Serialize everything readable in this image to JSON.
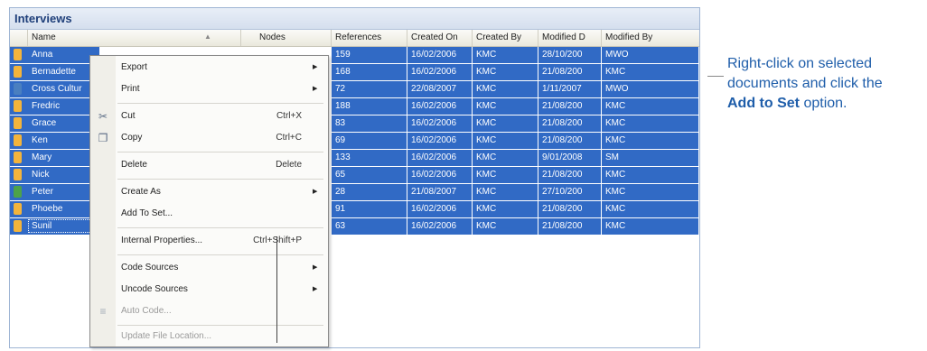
{
  "panel": {
    "title": "Interviews"
  },
  "columns": [
    "Name",
    "Nodes",
    "References",
    "Created On",
    "Created By",
    "Modified D",
    "Modified By"
  ],
  "rows": [
    {
      "name": "Anna",
      "icon": "yellow",
      "references": "159",
      "created_on": "16/02/2006",
      "created_by": "KMC",
      "modified_on": "28/10/200",
      "modified_by": "MWO"
    },
    {
      "name": "Bernadette",
      "icon": "yellow",
      "references": "168",
      "created_on": "16/02/2006",
      "created_by": "KMC",
      "modified_on": "21/08/200",
      "modified_by": "KMC"
    },
    {
      "name": "Cross Cultur",
      "icon": "blue",
      "references": "72",
      "created_on": "22/08/2007",
      "created_by": "KMC",
      "modified_on": "1/11/2007",
      "modified_by": "MWO"
    },
    {
      "name": "Fredric",
      "icon": "yellow",
      "references": "188",
      "created_on": "16/02/2006",
      "created_by": "KMC",
      "modified_on": "21/08/200",
      "modified_by": "KMC"
    },
    {
      "name": "Grace",
      "icon": "yellow",
      "references": "83",
      "created_on": "16/02/2006",
      "created_by": "KMC",
      "modified_on": "21/08/200",
      "modified_by": "KMC"
    },
    {
      "name": "Ken",
      "icon": "yellow",
      "references": "69",
      "created_on": "16/02/2006",
      "created_by": "KMC",
      "modified_on": "21/08/200",
      "modified_by": "KMC"
    },
    {
      "name": "Mary",
      "icon": "yellow",
      "references": "133",
      "created_on": "16/02/2006",
      "created_by": "KMC",
      "modified_on": "9/01/2008",
      "modified_by": "SM"
    },
    {
      "name": "Nick",
      "icon": "yellow",
      "references": "65",
      "created_on": "16/02/2006",
      "created_by": "KMC",
      "modified_on": "21/08/200",
      "modified_by": "KMC"
    },
    {
      "name": "Peter",
      "icon": "green",
      "references": "28",
      "created_on": "21/08/2007",
      "created_by": "KMC",
      "modified_on": "27/10/200",
      "modified_by": "KMC"
    },
    {
      "name": "Phoebe",
      "icon": "yellow",
      "references": "91",
      "created_on": "16/02/2006",
      "created_by": "KMC",
      "modified_on": "21/08/200",
      "modified_by": "KMC"
    },
    {
      "name": "Sunil",
      "icon": "yellow",
      "references": "63",
      "created_on": "16/02/2006",
      "created_by": "KMC",
      "modified_on": "21/08/200",
      "modified_by": "KMC"
    }
  ],
  "menu": {
    "export": "Export",
    "print": "Print",
    "cut": "Cut",
    "cut_shortcut": "Ctrl+X",
    "copy": "Copy",
    "copy_shortcut": "Ctrl+C",
    "delete": "Delete",
    "delete_shortcut": "Delete",
    "create_as": "Create As",
    "add_to_set": "Add To Set...",
    "internal_properties": "Internal Properties...",
    "internal_properties_shortcut": "Ctrl+Shift+P",
    "code_sources": "Code Sources",
    "uncode_sources": "Uncode Sources",
    "auto_code": "Auto Code...",
    "update_file_location": "Update File Location..."
  },
  "callout": {
    "line1": "Right-click on selected",
    "line2": "documents and click the",
    "bold": "Add to Set",
    "suffix": " option."
  },
  "colors": {
    "selection": "#316ac5",
    "callout_text": "#1f5eaa"
  },
  "icons": {
    "cut": "scissors-icon",
    "copy": "copy-icon",
    "auto_code": "auto-code-icon"
  }
}
